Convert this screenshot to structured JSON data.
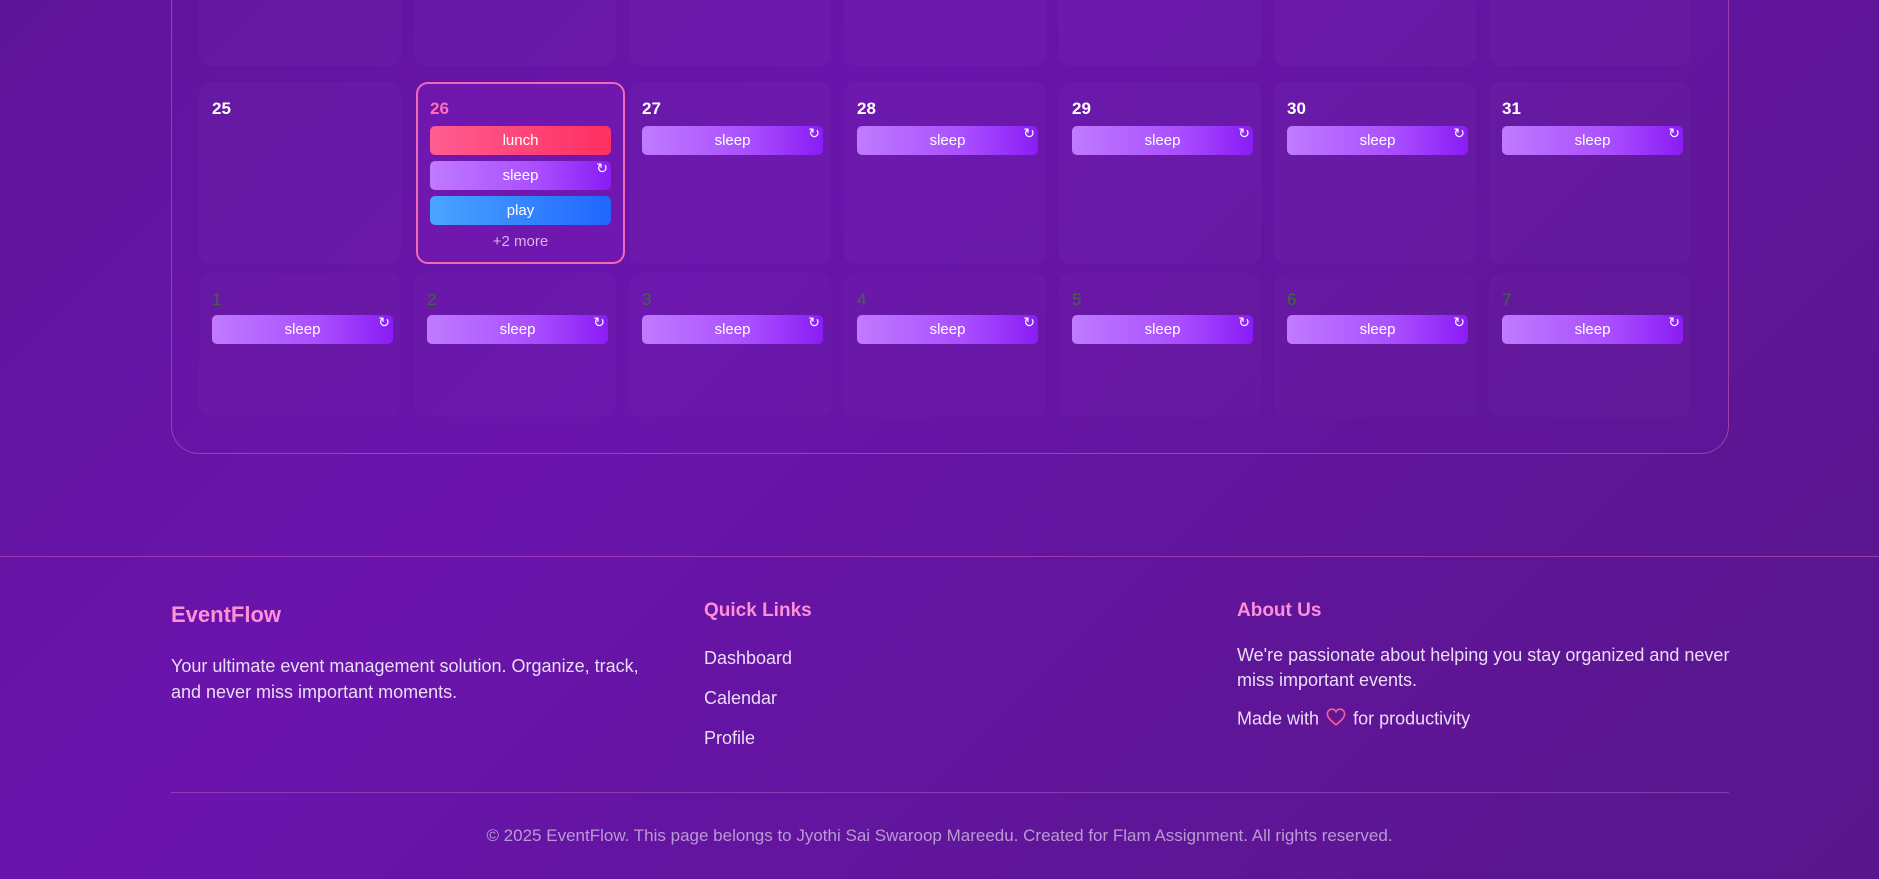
{
  "calendar": {
    "row2": [
      {
        "day": "25",
        "events": []
      },
      {
        "day": "26",
        "events": [
          "lunch",
          "sleep",
          "play"
        ],
        "more": "+2 more"
      },
      {
        "day": "27",
        "events": [
          "sleep"
        ]
      },
      {
        "day": "28",
        "events": [
          "sleep"
        ]
      },
      {
        "day": "29",
        "events": [
          "sleep"
        ]
      },
      {
        "day": "30",
        "events": [
          "sleep"
        ]
      },
      {
        "day": "31",
        "events": [
          "sleep"
        ]
      }
    ],
    "row3": [
      {
        "day": "1",
        "events": [
          "sleep"
        ]
      },
      {
        "day": "2",
        "events": [
          "sleep"
        ]
      },
      {
        "day": "3",
        "events": [
          "sleep"
        ]
      },
      {
        "day": "4",
        "events": [
          "sleep"
        ]
      },
      {
        "day": "5",
        "events": [
          "sleep"
        ]
      },
      {
        "day": "6",
        "events": [
          "sleep"
        ]
      },
      {
        "day": "7",
        "events": [
          "sleep"
        ]
      }
    ],
    "repeat_glyph": "↻"
  },
  "footer": {
    "brand": "EventFlow",
    "description": "Your ultimate event management solution. Organize, track, and never miss important moments.",
    "quick_links_title": "Quick Links",
    "links": [
      "Dashboard",
      "Calendar",
      "Profile"
    ],
    "about_title": "About Us",
    "about_text": "We're passionate about helping you stay organized and never miss important events.",
    "made_with_prefix": "Made with",
    "made_with_suffix": "for productivity",
    "copyright": "© 2025 EventFlow. This page belongs to Jyothi Sai Swaroop Mareedu. Created for Flam Assignment. All rights reserved."
  },
  "colors": {
    "accent_pink": "#ff8fd6",
    "today_border": "#f06ab5",
    "sleep": "#a94dff",
    "lunch": "#ff2f61",
    "play": "#2066ff",
    "heart": "#ff5d92"
  }
}
